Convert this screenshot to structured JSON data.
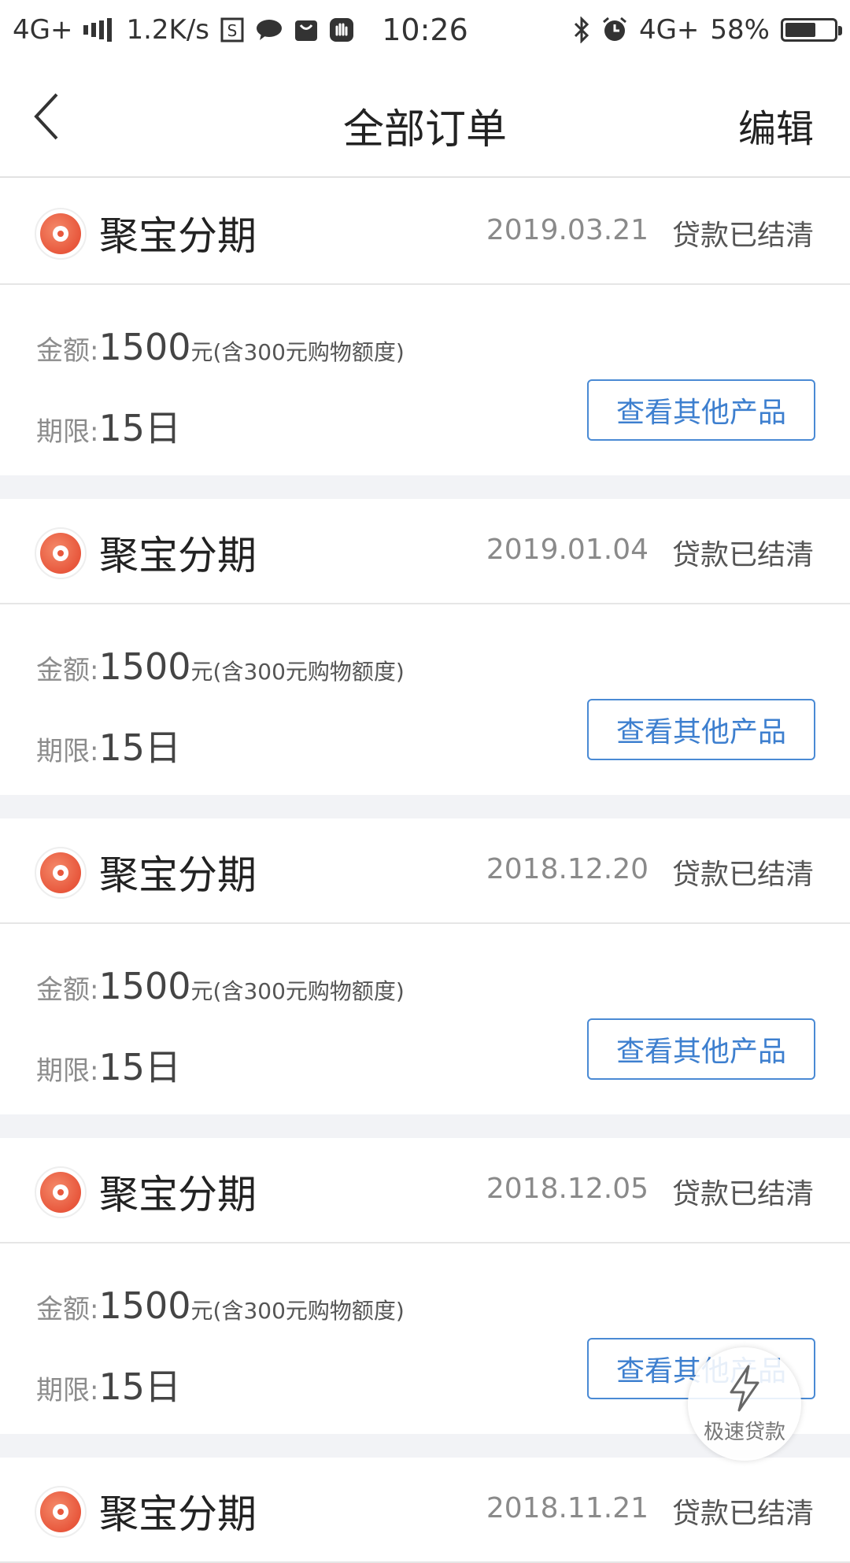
{
  "status_bar": {
    "network": "4G+",
    "speed": "1.2K/s",
    "time": "10:26",
    "network_right": "4G+",
    "battery": "58%",
    "battery_level": 0.58
  },
  "nav": {
    "title": "全部订单",
    "edit_label": "编辑"
  },
  "orders": [
    {
      "product": "聚宝分期",
      "date": "2019.03.21",
      "status": "贷款已结清",
      "amount_label": "金额:",
      "amount": "1500",
      "amount_note": "元(含300元购物额度)",
      "term_label": "期限:",
      "term": "15日",
      "button_label": "查看其他产品"
    },
    {
      "product": "聚宝分期",
      "date": "2019.01.04",
      "status": "贷款已结清",
      "amount_label": "金额:",
      "amount": "1500",
      "amount_note": "元(含300元购物额度)",
      "term_label": "期限:",
      "term": "15日",
      "button_label": "查看其他产品"
    },
    {
      "product": "聚宝分期",
      "date": "2018.12.20",
      "status": "贷款已结清",
      "amount_label": "金额:",
      "amount": "1500",
      "amount_note": "元(含300元购物额度)",
      "term_label": "期限:",
      "term": "15日",
      "button_label": "查看其他产品"
    },
    {
      "product": "聚宝分期",
      "date": "2018.12.05",
      "status": "贷款已结清",
      "amount_label": "金额:",
      "amount": "1500",
      "amount_note": "元(含300元购物额度)",
      "term_label": "期限:",
      "term": "15日",
      "button_label": "查看其他产品"
    },
    {
      "product": "聚宝分期",
      "date": "2018.11.21",
      "status": "贷款已结清"
    }
  ],
  "fab": {
    "label": "极速贷款",
    "icon": "lightning-icon"
  },
  "colors": {
    "accent_blue": "#3d7fcf",
    "brand_orange": "#e8573c",
    "divider_bg": "#f2f3f6"
  }
}
